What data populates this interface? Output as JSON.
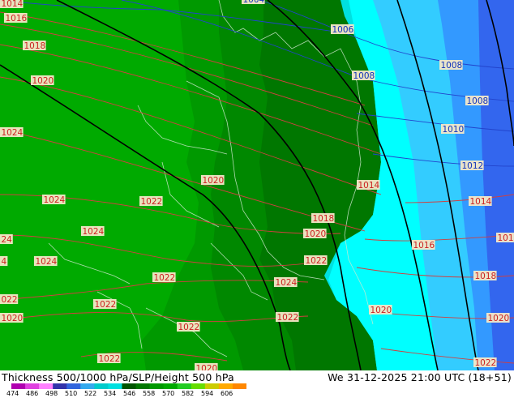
{
  "title": "Thickness 500/1000 hPa/SLP/Height 500 hPa",
  "valid_time": "We 31-12-2025 21:00 UTC (18+51)",
  "colorbar": {
    "ticks": [
      "474",
      "486",
      "498",
      "510",
      "522",
      "534",
      "546",
      "558",
      "570",
      "582",
      "594",
      "606"
    ],
    "colors": [
      "#b000b0",
      "#e040e0",
      "#ff80ff",
      "#3333aa",
      "#3366dd",
      "#33aaee",
      "#00cccc",
      "#00e0e0",
      "#005500",
      "#007700",
      "#009900",
      "#00aa00",
      "#22cc22",
      "#66dd00",
      "#cccc00",
      "#ffaa00",
      "#ff8800"
    ]
  },
  "pressure_labels": [
    {
      "text": "1014",
      "color": "red"
    },
    {
      "text": "1016",
      "color": "red"
    },
    {
      "text": "1018",
      "color": "red"
    },
    {
      "text": "1020",
      "color": "red"
    },
    {
      "text": "1024",
      "color": "red"
    },
    {
      "text": "1024",
      "color": "red"
    },
    {
      "text": "1022",
      "color": "red"
    },
    {
      "text": "1024",
      "color": "red"
    },
    {
      "text": "24",
      "color": "red"
    },
    {
      "text": "4",
      "color": "red"
    },
    {
      "text": "1024",
      "color": "red"
    },
    {
      "text": "022",
      "color": "red"
    },
    {
      "text": "1022",
      "color": "red"
    },
    {
      "text": "1020",
      "color": "red"
    },
    {
      "text": "1022",
      "color": "red"
    },
    {
      "text": "1022",
      "color": "red"
    },
    {
      "text": "1022",
      "color": "red"
    },
    {
      "text": "1022",
      "color": "red"
    },
    {
      "text": "1020",
      "color": "red"
    },
    {
      "text": "1020",
      "color": "red"
    },
    {
      "text": "1018",
      "color": "red"
    },
    {
      "text": "1020",
      "color": "red"
    },
    {
      "text": "1022",
      "color": "red"
    },
    {
      "text": "1024",
      "color": "red"
    },
    {
      "text": "1022",
      "color": "red"
    },
    {
      "text": "1014",
      "color": "red"
    },
    {
      "text": "1016",
      "color": "red"
    },
    {
      "text": "1020",
      "color": "red"
    },
    {
      "text": "1014",
      "color": "red"
    },
    {
      "text": "101",
      "color": "red"
    },
    {
      "text": "1018",
      "color": "red"
    },
    {
      "text": "1020",
      "color": "red"
    },
    {
      "text": "1022",
      "color": "red"
    },
    {
      "text": "1006",
      "color": "blue"
    },
    {
      "text": "1008",
      "color": "blue"
    },
    {
      "text": "1008",
      "color": "blue"
    },
    {
      "text": "1008",
      "color": "blue"
    },
    {
      "text": "1010",
      "color": "blue"
    },
    {
      "text": "1012",
      "color": "blue"
    },
    {
      "text": "1004",
      "color": "blue"
    }
  ]
}
